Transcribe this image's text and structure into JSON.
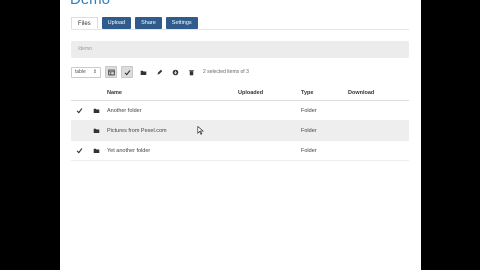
{
  "app": {
    "title": "Demo"
  },
  "tabs": {
    "files": "Files",
    "upload": "Upload",
    "share": "Share",
    "settings": "Settings"
  },
  "path": {
    "text": "/demo"
  },
  "toolbar": {
    "view_select": "table",
    "selection_status": "2 selected items of 3",
    "icons": [
      "table-view-icon",
      "check-icon",
      "folder-icon",
      "edit-icon",
      "download-icon",
      "trash-icon"
    ]
  },
  "table": {
    "columns": [
      "Name",
      "Uploaded",
      "Type",
      "Download"
    ],
    "rows": [
      {
        "name": "Another folder",
        "uploaded": "",
        "type": "Folder",
        "download": "",
        "selected": true
      },
      {
        "name": "Pictures from Pexel.com",
        "uploaded": "",
        "type": "Folder",
        "download": "",
        "selected": false
      },
      {
        "name": "Yet another folder",
        "uploaded": "",
        "type": "Folder",
        "download": "",
        "selected": true
      }
    ]
  },
  "colors": {
    "accent": "#2f7fbf",
    "button": "#2f5c8c",
    "row_highlight": "#eeeeee",
    "outside": "#000000"
  }
}
